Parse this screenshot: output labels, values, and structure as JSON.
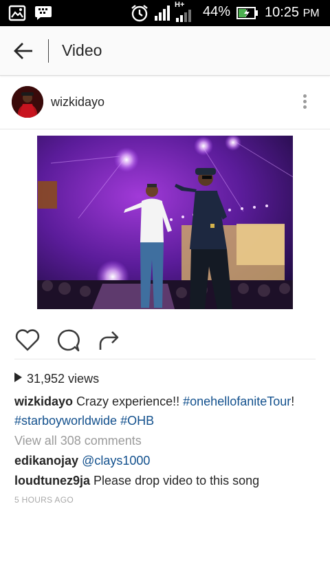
{
  "status_bar": {
    "network": "H+",
    "battery": "44%",
    "time": "10:25",
    "ampm": "PM"
  },
  "header": {
    "title": "Video"
  },
  "post": {
    "username": "wizkidayo",
    "views": "31,952 views",
    "caption": {
      "author": "wizkidayo",
      "text": "Crazy experience!!",
      "hashtag1": "#onehellofaniteTour",
      "punct": "!",
      "hashtag2": "#starboyworldwide",
      "hashtag3": "#OHB"
    },
    "view_comments": "View all 308 comments",
    "comments": [
      {
        "user": "edikanojay",
        "mention": "@clays1000",
        "text": ""
      },
      {
        "user": "loudtunez9ja",
        "mention": "",
        "text": "Please drop video to this song"
      }
    ],
    "timestamp": "5 HOURS AGO"
  },
  "icons": [
    "gallery-icon",
    "blackberry-messenger-icon",
    "alarm-icon",
    "signal-icon",
    "battery-icon",
    "back-arrow-icon",
    "more-vertical-icon",
    "heart-icon",
    "comment-icon",
    "share-icon",
    "play-icon"
  ]
}
